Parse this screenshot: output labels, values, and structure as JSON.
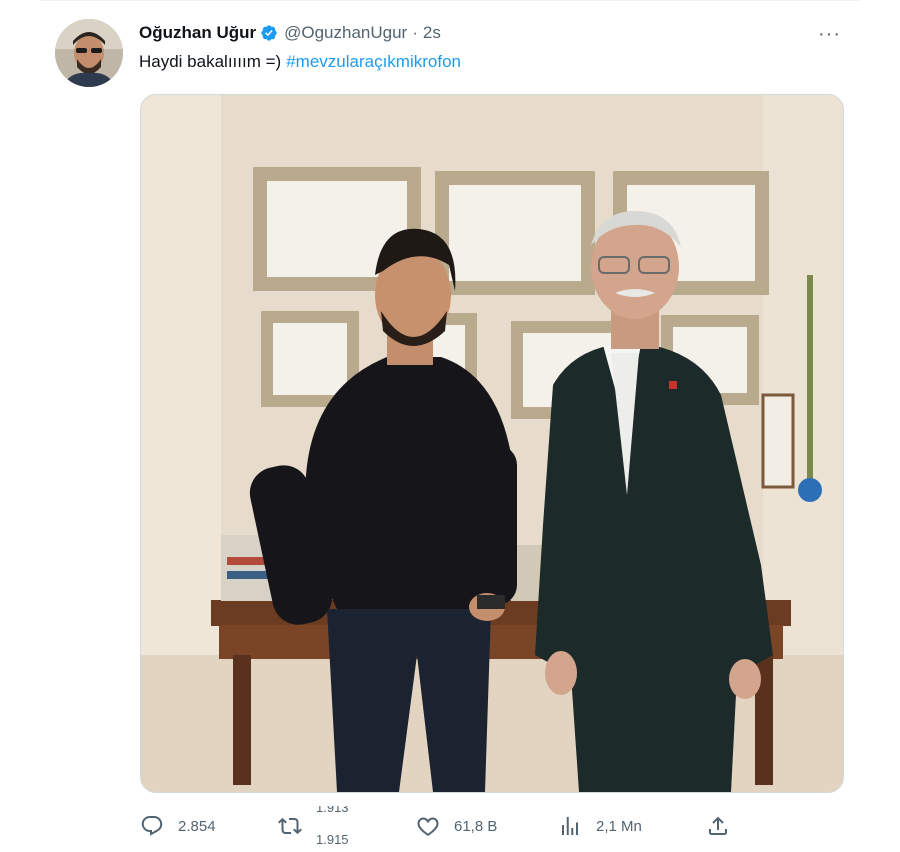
{
  "tweet": {
    "author_name": "Oğuzhan Uğur",
    "handle": "@OguzhanUgur",
    "separator": "·",
    "time": "2s",
    "text": "Haydi bakalıııım =)",
    "hashtag": "#mevzularaçıkmikrofon",
    "more_label": "···"
  },
  "actions": {
    "replies": "2.854",
    "retweets_old": "1.913",
    "retweets_new": "1.915",
    "likes": "61,8 B",
    "views": "2,1 Mn"
  },
  "colors": {
    "accent": "#1d9bf0",
    "text": "#0f1419",
    "muted": "#536471"
  },
  "icons": {
    "verified": "verified-badge-icon",
    "more": "more-icon",
    "reply": "reply-icon",
    "retweet": "retweet-icon",
    "like": "heart-icon",
    "views": "views-icon",
    "share": "share-icon"
  }
}
